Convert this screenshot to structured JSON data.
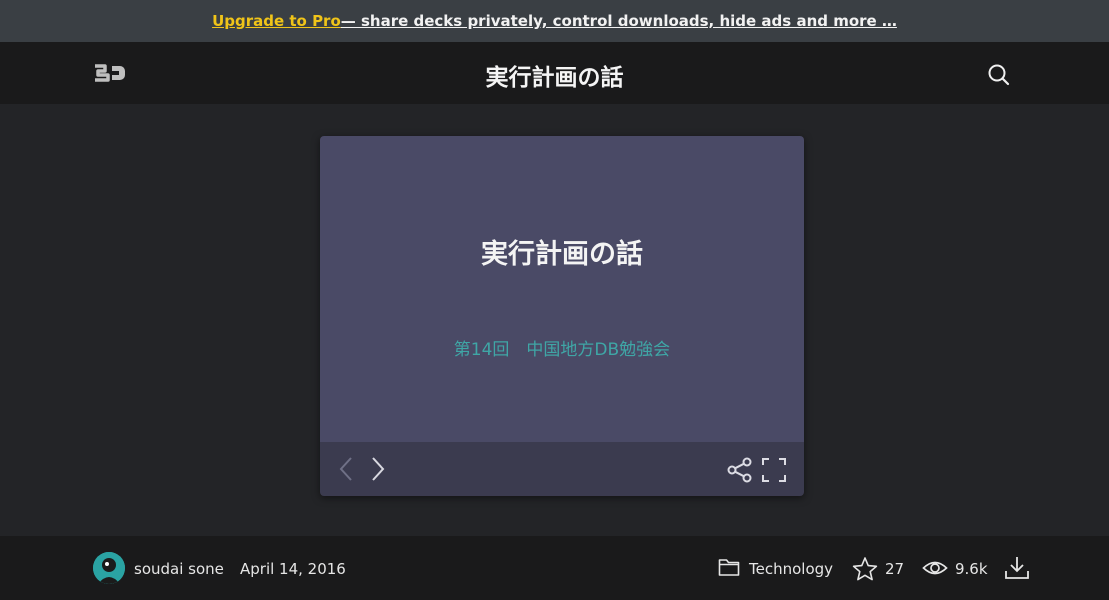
{
  "promo": {
    "link_text": "Upgrade to Pro",
    "rest_text": " — share decks privately, control downloads, hide ads and more …"
  },
  "header": {
    "logo_text": "SD",
    "title": "実行計画の話"
  },
  "slide": {
    "title": "実行計画の話",
    "subtitle": "第14回　中国地方DB勉強会"
  },
  "footer": {
    "author": "soudai sone",
    "date": "April 14, 2016",
    "category": "Technology",
    "stars": "27",
    "views": "9.6k"
  },
  "colors": {
    "promo_bg": "#3a3f44",
    "promo_link": "#f0c419",
    "slide_bg": "#4a4a66",
    "slide_subtitle": "#3fa6a6",
    "controls_bg": "#3b3b4f"
  },
  "icons": [
    "speakerdeck-logo-icon",
    "search-icon",
    "prev-arrow-icon",
    "next-arrow-icon",
    "share-icon",
    "fullscreen-icon",
    "folder-icon",
    "star-icon",
    "eye-icon",
    "download-icon"
  ]
}
